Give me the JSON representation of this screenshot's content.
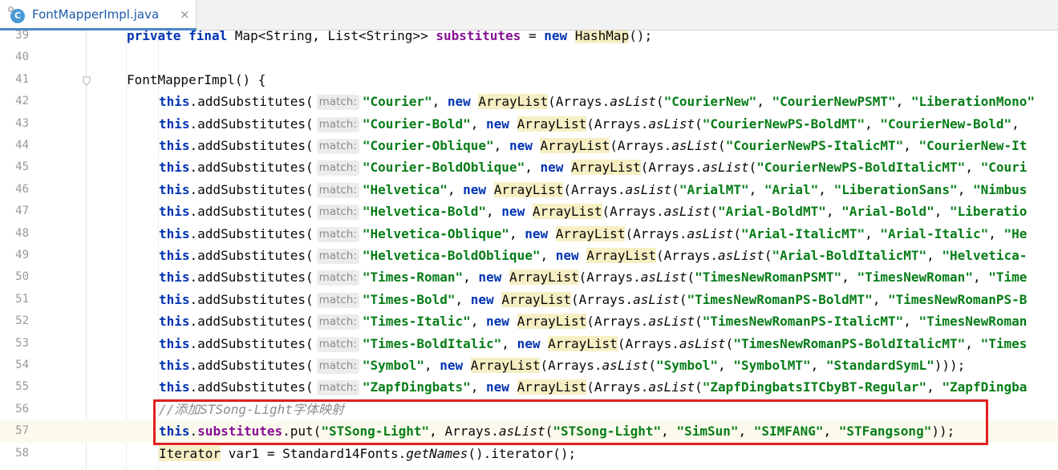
{
  "tab": {
    "icon_letter": "C",
    "title": "FontMapperImpl.java",
    "close_glyph": "×"
  },
  "lines": [
    {
      "num": "39",
      "parts": [
        [
          "kw",
          "private"
        ],
        [
          "p",
          " "
        ],
        [
          "kw",
          "final"
        ],
        [
          "p",
          " Map<String, List<String>> "
        ],
        [
          "field",
          "substitutes"
        ],
        [
          "p",
          " = "
        ],
        [
          "kw",
          "new"
        ],
        [
          "p",
          " "
        ],
        [
          "hl",
          "HashMap"
        ],
        [
          "p",
          "();"
        ]
      ]
    },
    {
      "num": "40",
      "parts": []
    },
    {
      "num": "41",
      "parts": [
        [
          "p",
          "FontMapperImpl() {"
        ]
      ]
    },
    {
      "num": "42",
      "hint": "match:",
      "parts": [
        [
          "kw",
          "this"
        ],
        [
          "p",
          ".addSubstitutes("
        ],
        [
          "hint",
          "match:"
        ],
        [
          "str",
          "\"Courier\""
        ],
        [
          "p",
          ", "
        ],
        [
          "kw",
          "new"
        ],
        [
          "p",
          " "
        ],
        [
          "hl",
          "ArrayList"
        ],
        [
          "p",
          "(Arrays."
        ],
        [
          "it",
          "asList"
        ],
        [
          "p",
          "("
        ],
        [
          "str",
          "\"CourierNew\""
        ],
        [
          "p",
          ", "
        ],
        [
          "str",
          "\"CourierNewPSMT\""
        ],
        [
          "p",
          ", "
        ],
        [
          "str",
          "\"LiberationMono\""
        ]
      ]
    },
    {
      "num": "43",
      "parts": [
        [
          "kw",
          "this"
        ],
        [
          "p",
          ".addSubstitutes("
        ],
        [
          "hint",
          "match:"
        ],
        [
          "str",
          "\"Courier-Bold\""
        ],
        [
          "p",
          ", "
        ],
        [
          "kw",
          "new"
        ],
        [
          "p",
          " "
        ],
        [
          "hl",
          "ArrayList"
        ],
        [
          "p",
          "(Arrays."
        ],
        [
          "it",
          "asList"
        ],
        [
          "p",
          "("
        ],
        [
          "str",
          "\"CourierNewPS-BoldMT\""
        ],
        [
          "p",
          ", "
        ],
        [
          "str",
          "\"CourierNew-Bold\""
        ],
        [
          "p",
          ", "
        ]
      ]
    },
    {
      "num": "44",
      "parts": [
        [
          "kw",
          "this"
        ],
        [
          "p",
          ".addSubstitutes("
        ],
        [
          "hint",
          "match:"
        ],
        [
          "str",
          "\"Courier-Oblique\""
        ],
        [
          "p",
          ", "
        ],
        [
          "kw",
          "new"
        ],
        [
          "p",
          " "
        ],
        [
          "hl",
          "ArrayList"
        ],
        [
          "p",
          "(Arrays."
        ],
        [
          "it",
          "asList"
        ],
        [
          "p",
          "("
        ],
        [
          "str",
          "\"CourierNewPS-ItalicMT\""
        ],
        [
          "p",
          ", "
        ],
        [
          "str",
          "\"CourierNew-It"
        ]
      ]
    },
    {
      "num": "45",
      "parts": [
        [
          "kw",
          "this"
        ],
        [
          "p",
          ".addSubstitutes("
        ],
        [
          "hint",
          "match:"
        ],
        [
          "str",
          "\"Courier-BoldOblique\""
        ],
        [
          "p",
          ", "
        ],
        [
          "kw",
          "new"
        ],
        [
          "p",
          " "
        ],
        [
          "hl",
          "ArrayList"
        ],
        [
          "p",
          "(Arrays."
        ],
        [
          "it",
          "asList"
        ],
        [
          "p",
          "("
        ],
        [
          "str",
          "\"CourierNewPS-BoldItalicMT\""
        ],
        [
          "p",
          ", "
        ],
        [
          "str",
          "\"Couri"
        ]
      ]
    },
    {
      "num": "46",
      "parts": [
        [
          "kw",
          "this"
        ],
        [
          "p",
          ".addSubstitutes("
        ],
        [
          "hint",
          "match:"
        ],
        [
          "str",
          "\"Helvetica\""
        ],
        [
          "p",
          ", "
        ],
        [
          "kw",
          "new"
        ],
        [
          "p",
          " "
        ],
        [
          "hl",
          "ArrayList"
        ],
        [
          "p",
          "(Arrays."
        ],
        [
          "it",
          "asList"
        ],
        [
          "p",
          "("
        ],
        [
          "str",
          "\"ArialMT\""
        ],
        [
          "p",
          ", "
        ],
        [
          "str",
          "\"Arial\""
        ],
        [
          "p",
          ", "
        ],
        [
          "str",
          "\"LiberationSans\""
        ],
        [
          "p",
          ", "
        ],
        [
          "str",
          "\"Nimbus"
        ]
      ]
    },
    {
      "num": "47",
      "parts": [
        [
          "kw",
          "this"
        ],
        [
          "p",
          ".addSubstitutes("
        ],
        [
          "hint",
          "match:"
        ],
        [
          "str",
          "\"Helvetica-Bold\""
        ],
        [
          "p",
          ", "
        ],
        [
          "kw",
          "new"
        ],
        [
          "p",
          " "
        ],
        [
          "hl",
          "ArrayList"
        ],
        [
          "p",
          "(Arrays."
        ],
        [
          "it",
          "asList"
        ],
        [
          "p",
          "("
        ],
        [
          "str",
          "\"Arial-BoldMT\""
        ],
        [
          "p",
          ", "
        ],
        [
          "str",
          "\"Arial-Bold\""
        ],
        [
          "p",
          ", "
        ],
        [
          "str",
          "\"Liberatio"
        ]
      ]
    },
    {
      "num": "48",
      "parts": [
        [
          "kw",
          "this"
        ],
        [
          "p",
          ".addSubstitutes("
        ],
        [
          "hint",
          "match:"
        ],
        [
          "str",
          "\"Helvetica-Oblique\""
        ],
        [
          "p",
          ", "
        ],
        [
          "kw",
          "new"
        ],
        [
          "p",
          " "
        ],
        [
          "hl",
          "ArrayList"
        ],
        [
          "p",
          "(Arrays."
        ],
        [
          "it",
          "asList"
        ],
        [
          "p",
          "("
        ],
        [
          "str",
          "\"Arial-ItalicMT\""
        ],
        [
          "p",
          ", "
        ],
        [
          "str",
          "\"Arial-Italic\""
        ],
        [
          "p",
          ", "
        ],
        [
          "str",
          "\"He"
        ]
      ]
    },
    {
      "num": "49",
      "parts": [
        [
          "kw",
          "this"
        ],
        [
          "p",
          ".addSubstitutes("
        ],
        [
          "hint",
          "match:"
        ],
        [
          "str",
          "\"Helvetica-BoldOblique\""
        ],
        [
          "p",
          ", "
        ],
        [
          "kw",
          "new"
        ],
        [
          "p",
          " "
        ],
        [
          "hl",
          "ArrayList"
        ],
        [
          "p",
          "(Arrays."
        ],
        [
          "it",
          "asList"
        ],
        [
          "p",
          "("
        ],
        [
          "str",
          "\"Arial-BoldItalicMT\""
        ],
        [
          "p",
          ", "
        ],
        [
          "str",
          "\"Helvetica-"
        ]
      ]
    },
    {
      "num": "50",
      "parts": [
        [
          "kw",
          "this"
        ],
        [
          "p",
          ".addSubstitutes("
        ],
        [
          "hint",
          "match:"
        ],
        [
          "str",
          "\"Times-Roman\""
        ],
        [
          "p",
          ", "
        ],
        [
          "kw",
          "new"
        ],
        [
          "p",
          " "
        ],
        [
          "hl",
          "ArrayList"
        ],
        [
          "p",
          "(Arrays."
        ],
        [
          "it",
          "asList"
        ],
        [
          "p",
          "("
        ],
        [
          "str",
          "\"TimesNewRomanPSMT\""
        ],
        [
          "p",
          ", "
        ],
        [
          "str",
          "\"TimesNewRoman\""
        ],
        [
          "p",
          ", "
        ],
        [
          "str",
          "\"Time"
        ]
      ]
    },
    {
      "num": "51",
      "parts": [
        [
          "kw",
          "this"
        ],
        [
          "p",
          ".addSubstitutes("
        ],
        [
          "hint",
          "match:"
        ],
        [
          "str",
          "\"Times-Bold\""
        ],
        [
          "p",
          ", "
        ],
        [
          "kw",
          "new"
        ],
        [
          "p",
          " "
        ],
        [
          "hl",
          "ArrayList"
        ],
        [
          "p",
          "(Arrays."
        ],
        [
          "it",
          "asList"
        ],
        [
          "p",
          "("
        ],
        [
          "str",
          "\"TimesNewRomanPS-BoldMT\""
        ],
        [
          "p",
          ", "
        ],
        [
          "str",
          "\"TimesNewRomanPS-B"
        ]
      ]
    },
    {
      "num": "52",
      "parts": [
        [
          "kw",
          "this"
        ],
        [
          "p",
          ".addSubstitutes("
        ],
        [
          "hint",
          "match:"
        ],
        [
          "str",
          "\"Times-Italic\""
        ],
        [
          "p",
          ", "
        ],
        [
          "kw",
          "new"
        ],
        [
          "p",
          " "
        ],
        [
          "hl",
          "ArrayList"
        ],
        [
          "p",
          "(Arrays."
        ],
        [
          "it",
          "asList"
        ],
        [
          "p",
          "("
        ],
        [
          "str",
          "\"TimesNewRomanPS-ItalicMT\""
        ],
        [
          "p",
          ", "
        ],
        [
          "str",
          "\"TimesNewRoman"
        ]
      ]
    },
    {
      "num": "53",
      "parts": [
        [
          "kw",
          "this"
        ],
        [
          "p",
          ".addSubstitutes("
        ],
        [
          "hint",
          "match:"
        ],
        [
          "str",
          "\"Times-BoldItalic\""
        ],
        [
          "p",
          ", "
        ],
        [
          "kw",
          "new"
        ],
        [
          "p",
          " "
        ],
        [
          "hl",
          "ArrayList"
        ],
        [
          "p",
          "(Arrays."
        ],
        [
          "it",
          "asList"
        ],
        [
          "p",
          "("
        ],
        [
          "str",
          "\"TimesNewRomanPS-BoldItalicMT\""
        ],
        [
          "p",
          ", "
        ],
        [
          "str",
          "\"Times"
        ]
      ]
    },
    {
      "num": "54",
      "parts": [
        [
          "kw",
          "this"
        ],
        [
          "p",
          ".addSubstitutes("
        ],
        [
          "hint",
          "match:"
        ],
        [
          "str",
          "\"Symbol\""
        ],
        [
          "p",
          ", "
        ],
        [
          "kw",
          "new"
        ],
        [
          "p",
          " "
        ],
        [
          "hl",
          "ArrayList"
        ],
        [
          "p",
          "(Arrays."
        ],
        [
          "it",
          "asList"
        ],
        [
          "p",
          "("
        ],
        [
          "str",
          "\"Symbol\""
        ],
        [
          "p",
          ", "
        ],
        [
          "str",
          "\"SymbolMT\""
        ],
        [
          "p",
          ", "
        ],
        [
          "str",
          "\"StandardSymL\""
        ],
        [
          "p",
          ")));"
        ]
      ]
    },
    {
      "num": "55",
      "parts": [
        [
          "kw",
          "this"
        ],
        [
          "p",
          ".addSubstitutes("
        ],
        [
          "hint",
          "match:"
        ],
        [
          "str",
          "\"ZapfDingbats\""
        ],
        [
          "p",
          ", "
        ],
        [
          "kw",
          "new"
        ],
        [
          "p",
          " "
        ],
        [
          "hl",
          "ArrayList"
        ],
        [
          "p",
          "(Arrays."
        ],
        [
          "it",
          "asList"
        ],
        [
          "p",
          "("
        ],
        [
          "str",
          "\"ZapfDingbatsITCbyBT-Regular\""
        ],
        [
          "p",
          ", "
        ],
        [
          "str",
          "\"ZapfDingba"
        ]
      ]
    },
    {
      "num": "56",
      "parts": [
        [
          "cm",
          "//添加STSong-Light字体映射"
        ]
      ]
    },
    {
      "num": "57",
      "parts": [
        [
          "kw",
          "this"
        ],
        [
          "p",
          "."
        ],
        [
          "field",
          "substitutes"
        ],
        [
          "p",
          ".put("
        ],
        [
          "str",
          "\"STSong-Light\""
        ],
        [
          "p",
          ", Arrays."
        ],
        [
          "it",
          "asList"
        ],
        [
          "p",
          "("
        ],
        [
          "str",
          "\"STSong-Light\""
        ],
        [
          "p",
          ", "
        ],
        [
          "str",
          "\"SimSun\""
        ],
        [
          "p",
          ", "
        ],
        [
          "str",
          "\"SIMFANG\""
        ],
        [
          "p",
          ", "
        ],
        [
          "str",
          "\"STFangsong\""
        ],
        [
          "p",
          "));"
        ]
      ]
    },
    {
      "num": "58",
      "parts": [
        [
          "hl",
          "Iterator"
        ],
        [
          "p",
          " var1 = Standard14Fonts."
        ],
        [
          "it",
          "getNames"
        ],
        [
          "p",
          "().iterator();"
        ]
      ]
    }
  ]
}
